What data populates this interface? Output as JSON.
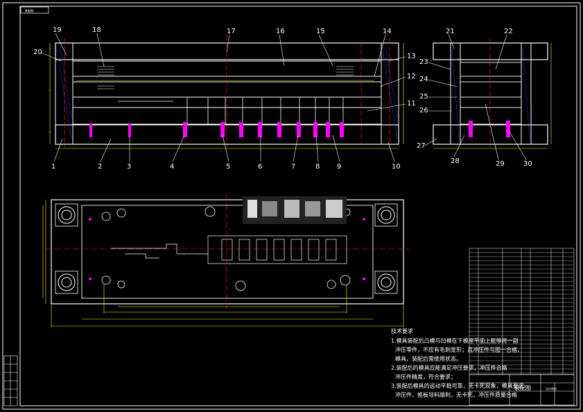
{
  "title_tab": "装配图",
  "colors": {
    "frame": "#ffffff",
    "plate": "#ffffff",
    "yellow": "#ffff00",
    "green": "#00ff00",
    "red": "#ff2020",
    "magenta": "#ff00ff",
    "cyan": "#00ffff",
    "blue": "#3050ff"
  },
  "front_view_callouts_top": [
    "19",
    "18",
    "17",
    "16",
    "15",
    "14"
  ],
  "front_view_callouts_side_left": [
    "20"
  ],
  "front_view_callouts_side_right": [
    "13",
    "12",
    "11"
  ],
  "front_view_callouts_bottom": [
    "1",
    "2",
    "3",
    "4",
    "5",
    "6",
    "7",
    "8",
    "9",
    "10"
  ],
  "side_view_callouts_top": [
    "21",
    "22"
  ],
  "side_view_callouts_left": [
    "23",
    "24",
    "25",
    "26",
    "27"
  ],
  "side_view_callouts_bottom": [
    "28",
    "29",
    "30"
  ],
  "tech_requirements": {
    "heading": "技术要求",
    "lines": [
      "1.模具装配后凸模与凹模在下模座平面上能够将一副",
      "冲压零件，不应有毛刺变形；且冲压件与图一合格，",
      "模具，装配后需使用状态。",
      "2.装配后的模具应能满足冲压要求，冲压件合格",
      "冲压件精度，符合要求；",
      "3.装配后模具的运动平稳可靠，无卡死现象，模具要求",
      "冲压件，推板导料顺利，无卡死，冲压件质量合格"
    ]
  },
  "title_block": {
    "drawing_name": "装配图",
    "school": "设计院校"
  }
}
